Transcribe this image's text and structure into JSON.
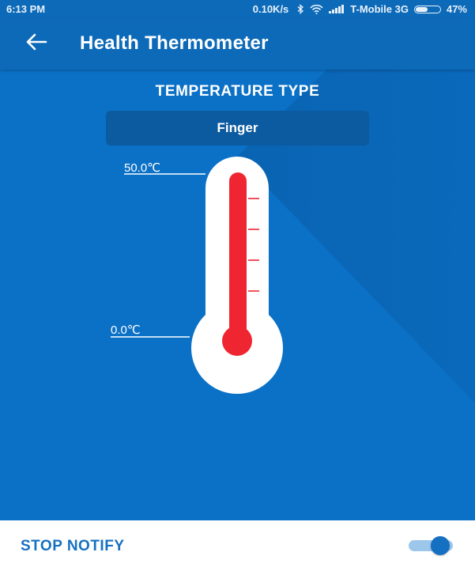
{
  "status_bar": {
    "time": "6:13 PM",
    "network_speed": "0.10K/s",
    "carrier": "T-Mobile 3G",
    "battery": "47%",
    "icons": [
      "bluetooth-icon",
      "wifi-icon",
      "signal-icon",
      "battery-icon"
    ]
  },
  "app_bar": {
    "title": "Health Thermometer",
    "back_icon": "back-arrow-icon"
  },
  "main": {
    "section_title": "TEMPERATURE TYPE",
    "temperature_type": "Finger",
    "scale_max": "50.0℃",
    "scale_min": "0.0℃",
    "mercury_fraction": 1.0
  },
  "bottom": {
    "stop_notify_label": "STOP NOTIFY",
    "notify_toggle_on": true
  },
  "colors": {
    "app_bar": "#0d6ab8",
    "background": "#0b71c6",
    "select_bg": "#0c5aa0",
    "mercury": "#ef2631",
    "accent": "#1670c2"
  }
}
